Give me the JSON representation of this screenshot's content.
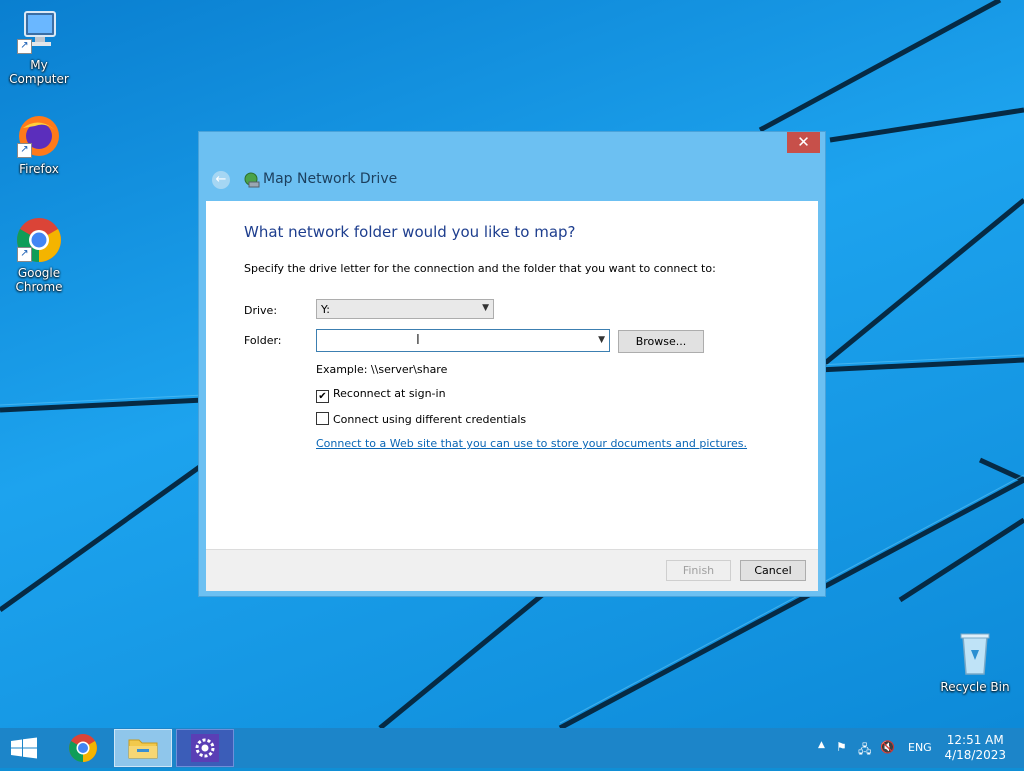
{
  "desktop": {
    "icons": [
      {
        "label": "My Computer",
        "icon": "computer-icon"
      },
      {
        "label": "Firefox",
        "icon": "firefox-icon"
      },
      {
        "label": "Google Chrome",
        "icon": "chrome-icon"
      },
      {
        "label": "Recycle Bin",
        "icon": "recycle-bin-icon"
      }
    ]
  },
  "dialog": {
    "title": "Map Network Drive",
    "close_glyph": "✕",
    "heading": "What network folder would you like to map?",
    "instruction": "Specify the drive letter for the connection and the folder that you want to connect to:",
    "drive_label": "Drive:",
    "drive_value": "Y:",
    "folder_label": "Folder:",
    "folder_value": "",
    "browse_label": "Browse...",
    "example_text": "Example: \\\\server\\share",
    "reconnect_label": "Reconnect at sign-in",
    "reconnect_checked": true,
    "credentials_label": "Connect using different credentials",
    "credentials_checked": false,
    "web_link": "Connect to a Web site that you can use to store your documents and pictures",
    "web_link_suffix": ".",
    "finish_label": "Finish",
    "cancel_label": "Cancel"
  },
  "taskbar": {
    "apps": [
      "chrome-icon",
      "file-explorer-icon",
      "settings-icon"
    ],
    "active_app": "file-explorer-icon",
    "language": "ENG",
    "time": "12:51 AM",
    "date": "4/18/2023"
  },
  "colors": {
    "desktop_bg": "#0f8fd6",
    "dialog_frame": "#6cc0f2",
    "heading": "#1e3e8e",
    "link": "#0a66b5",
    "close": "#c7504a",
    "taskbar": "#1c85c9"
  }
}
